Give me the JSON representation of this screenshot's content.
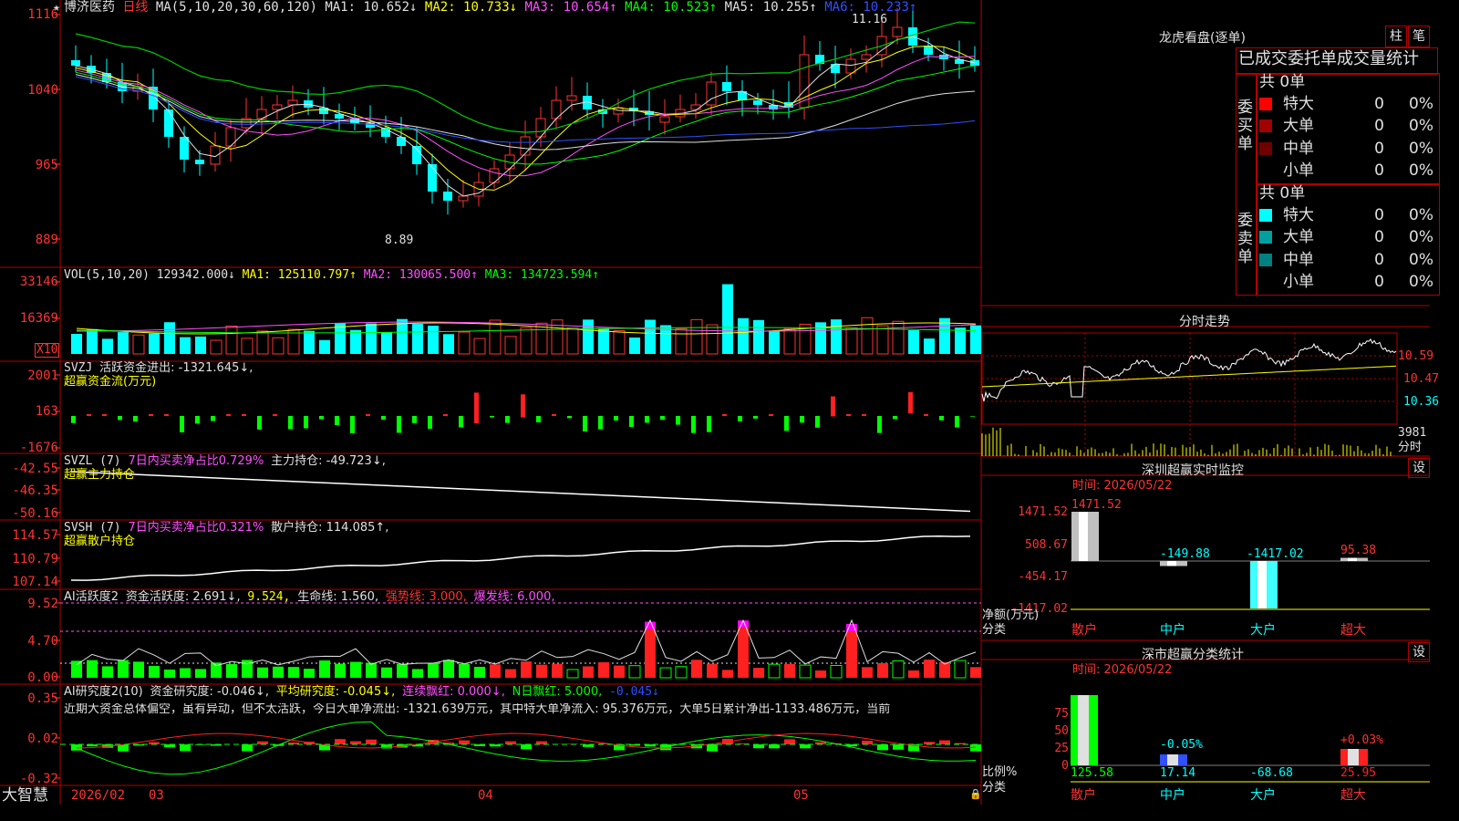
{
  "stock": {
    "star": "★",
    "name": "博济医药",
    "period": "日线",
    "ma_title": "MA(5,10,20,30,60,120)",
    "ma": [
      {
        "t": "MA1: 10.652↓",
        "c": "#e0e0e0"
      },
      {
        "t": "MA2: 10.733↓",
        "c": "#ffff00"
      },
      {
        "t": "MA3: 10.654↑",
        "c": "#ff50ff"
      },
      {
        "t": "MA4: 10.523↑",
        "c": "#00ff00"
      },
      {
        "t": "MA5: 10.255↑",
        "c": "#e0e0e0"
      },
      {
        "t": "MA6: 10.233↑",
        "c": "#3050ff"
      }
    ],
    "price_axis": [
      "1116",
      "1040",
      "965",
      "889"
    ],
    "high_mark": "11.16",
    "low_mark": "8.89"
  },
  "vol": {
    "title": "VOL(5,10,20)",
    "value": "129342.000↓",
    "ma1": "MA1: 125110.797↑",
    "ma2": "MA2: 130065.500↑",
    "ma3": "MA3: 134723.594↑",
    "axis": [
      "33146",
      "16369"
    ],
    "unit": "X10"
  },
  "svzj": {
    "title": "SVZJ",
    "label": "活跃资金进出: -1321.645↓,",
    "sub": "超赢资金流(万元)",
    "axis": [
      "2001",
      "163",
      "-1676"
    ]
  },
  "svzl": {
    "title": "SVZL (7)",
    "ratio": "7日内买卖净占比0.729%",
    "hold": "主力持仓: -49.723↓,",
    "sub": "超赢主力持仓",
    "axis": [
      "-42.55",
      "-46.35",
      "-50.16"
    ]
  },
  "svsh": {
    "title": "SVSH (7)",
    "ratio": "7日内买卖净占比0.321%",
    "hold": "散户持仓: 114.085↑,",
    "sub": "超赢散户持仓",
    "axis": [
      "114.57",
      "110.79",
      "107.14"
    ]
  },
  "ai1": {
    "title": "AI活跃度2",
    "l1": "资金活跃度: 2.691↓,",
    "l2": "9.524,",
    "l3": "生命线: 1.560,",
    "l4": "强势线: 3.000,",
    "l5": "爆发线: 6.000,",
    "axis": [
      "9.52",
      "4.70",
      "0.00"
    ]
  },
  "ai2": {
    "title": "AI研究度2(10)",
    "l1": "资金研究度: -0.046↓,",
    "l2": "平均研究度: -0.045↓,",
    "l3": "连续飘红: 0.000↓,",
    "l4": "N日飘红: 5.000,",
    "l5": "-0.045↓",
    "text": "近期大资金总体偏空，虽有异动，但不太活跃，今日大单净流出: -1321.639万元，其中特大单净流入: 95.376万元，大单5日累计净出-1133.486万元，当前",
    "axis": [
      "0.35",
      "0.02",
      "-0.32"
    ]
  },
  "bottom": {
    "brand": "大智慧",
    "d1": "2026/02",
    "d2": "03",
    "d3": "04",
    "d4": "05"
  },
  "lhb": {
    "title": "龙虎看盘(逐单)",
    "btn1": "柱",
    "btn2": "笔",
    "header": "已成交委托单成交量统计",
    "buy_side": "委买单",
    "sell_side": "委卖单",
    "buy_total": "共 0单",
    "sell_total": "共 0单",
    "buy_rows": [
      {
        "n": "特大",
        "v": "0",
        "p": "0%",
        "c": "#ff0000"
      },
      {
        "n": "大单",
        "v": "0",
        "p": "0%",
        "c": "#a00000"
      },
      {
        "n": "中单",
        "v": "0",
        "p": "0%",
        "c": "#700000"
      },
      {
        "n": "小单",
        "v": "0",
        "p": "0%",
        "c": "#000000"
      }
    ],
    "sell_rows": [
      {
        "n": "特大",
        "v": "0",
        "p": "0%",
        "c": "#00ffff"
      },
      {
        "n": "大单",
        "v": "0",
        "p": "0%",
        "c": "#00a0a0"
      },
      {
        "n": "中单",
        "v": "0",
        "p": "0%",
        "c": "#008080"
      },
      {
        "n": "小单",
        "v": "0",
        "p": "0%",
        "c": "#000000"
      }
    ]
  },
  "fs": {
    "title": "分时走势",
    "axis": [
      "10.59",
      "10.47",
      "10.36",
      "3981"
    ],
    "unit": "分时"
  },
  "monitor": {
    "title": "深圳超赢实时监控",
    "btn": "设",
    "time": "时间: 2026/05/22",
    "axis": [
      "1471.52",
      "508.67",
      "-454.17",
      "-1417.02"
    ],
    "ylabel1": "净额(万元)",
    "ylabel2": "分类",
    "bars": [
      {
        "v": "1471.52",
        "value": 1471.52,
        "cat": "散户"
      },
      {
        "v": "-149.88",
        "value": -149.88,
        "cat": "中户"
      },
      {
        "v": "-1417.02",
        "value": -1417.02,
        "cat": "大户"
      },
      {
        "v": "95.38",
        "value": 95.38,
        "cat": "超大"
      }
    ]
  },
  "classify": {
    "title": "深市超赢分类统计",
    "btn": "设",
    "time": "时间: 2026/05/22",
    "axis": [
      "75",
      "50",
      "25",
      "0"
    ],
    "ylabel1": "比例%",
    "ylabel2": "分类",
    "bars": [
      {
        "v": "125.58",
        "pct": "",
        "value": 125.58,
        "cat": "散户"
      },
      {
        "v": "17.14",
        "pct": "-0.05%",
        "value": 17.14,
        "cat": "中户"
      },
      {
        "v": "-68.68",
        "pct": "",
        "value": -68.68,
        "cat": "大户"
      },
      {
        "v": "25.95",
        "pct": "+0.03%",
        "value": 25.95,
        "cat": "超大"
      }
    ]
  }
}
